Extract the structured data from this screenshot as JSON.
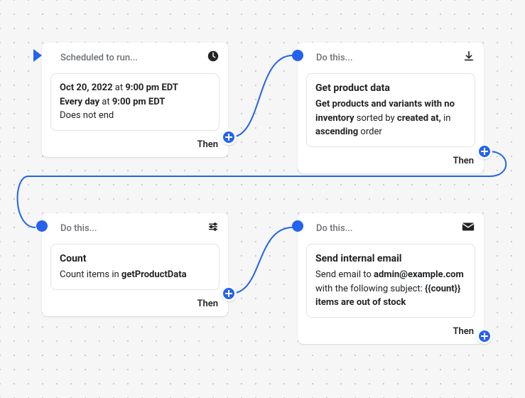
{
  "nodes": {
    "n1": {
      "header": "Scheduled to run...",
      "date": "Oct 20, 2022",
      "at_label_1": " at ",
      "time_1": "9:00 pm EDT",
      "everyday_label": "Every day",
      "at_label_2": " at ",
      "time_2": "9:00 pm EDT",
      "end_text": "Does not end",
      "then": "Then"
    },
    "n2": {
      "header": "Do this...",
      "title": "Get product data",
      "p1a": "Get products and variants with no inventory",
      "p1b": " sorted by ",
      "p1c": "created at,",
      "p1d": " in ",
      "p1e": "ascending",
      "p1f": " order",
      "then": "Then"
    },
    "n3": {
      "header": "Do this...",
      "title": "Count",
      "p1a": "Count items in ",
      "p1b": "getProductData",
      "then": "Then"
    },
    "n4": {
      "header": "Do this...",
      "title": "Send internal email",
      "p1a": "Send email to ",
      "p1b": "admin@example.com",
      "p1c": " with the following subject: ",
      "p1d": "{{count}} items are out of stock",
      "then": "Then"
    }
  }
}
